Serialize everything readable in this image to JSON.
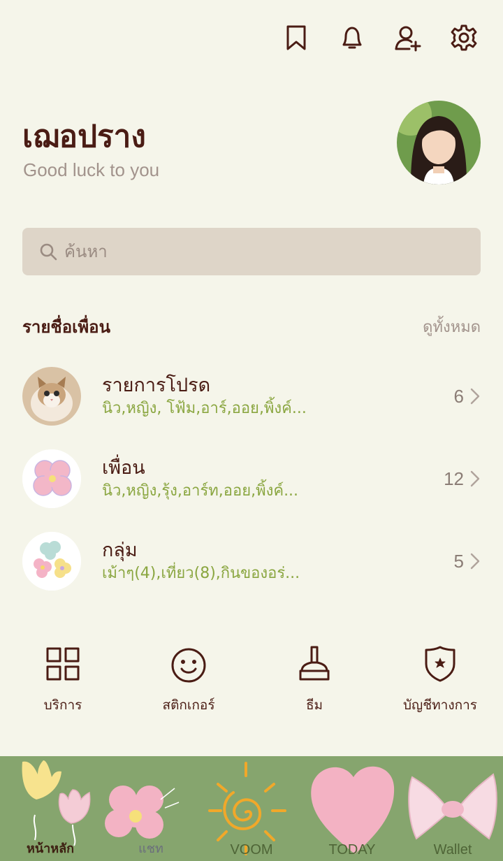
{
  "top_icons": [
    "bookmark-icon",
    "bell-icon",
    "add-friend-icon",
    "settings-icon"
  ],
  "profile": {
    "name": "เฌอปราง",
    "status": "Good luck to you"
  },
  "search": {
    "placeholder": "ค้นหา"
  },
  "friends": {
    "title": "รายชื่อเพื่อน",
    "see_all": "ดูทั้งหมด",
    "rows": [
      {
        "title": "รายการโปรด",
        "sub": "นิว,หญิง, โฟ้ม,อาร์,ออย,พิ้งค์...",
        "count": "6"
      },
      {
        "title": "เพื่อน",
        "sub": "นิว,หญิง,รุ้ง,อาร์ท,ออย,พิ้งค์...",
        "count": "12"
      },
      {
        "title": "กลุ่ม",
        "sub": "เม้าๆ(4),เที่ยว(8),กินของอร่...",
        "count": "5"
      }
    ]
  },
  "services": [
    {
      "label": "บริการ",
      "icon": "grid-icon"
    },
    {
      "label": "สติกเกอร์",
      "icon": "smiley-icon"
    },
    {
      "label": "ธีม",
      "icon": "brush-icon"
    },
    {
      "label": "บัญชีทางการ",
      "icon": "shield-star-icon"
    }
  ],
  "tabs": [
    {
      "label": "หน้าหลัก",
      "icon": "tulip-icon"
    },
    {
      "label": "แชท",
      "icon": "flower-icon"
    },
    {
      "label": "VOOM",
      "icon": "sun-icon"
    },
    {
      "label": "TODAY",
      "icon": "heart-icon"
    },
    {
      "label": "Wallet",
      "icon": "bow-icon"
    }
  ],
  "colors": {
    "background": "#f5f5ea",
    "text_primary": "#4a1c14",
    "text_secondary": "#a2938c",
    "accent_green": "#8aa640",
    "search_bg": "#ded5c8",
    "tabbar_bg": "#86a56e"
  }
}
